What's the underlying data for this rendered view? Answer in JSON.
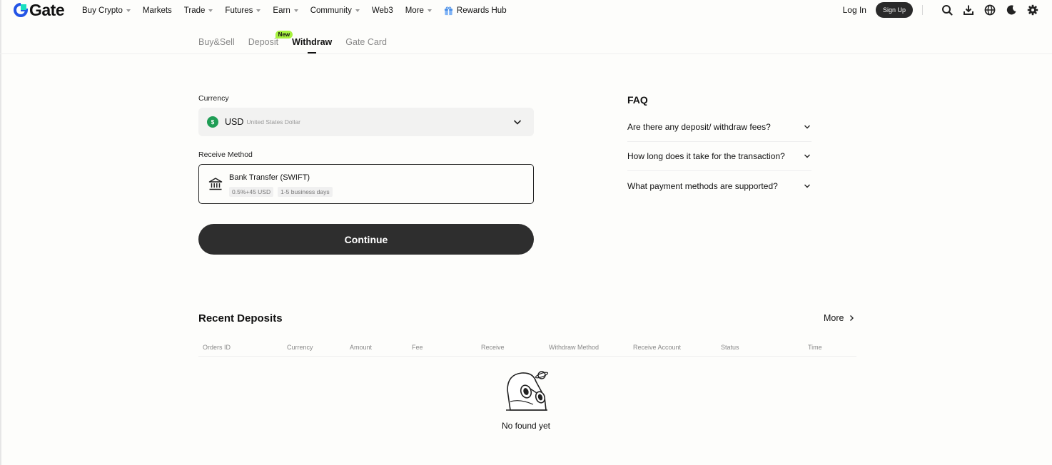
{
  "header": {
    "logo_text": "Gate",
    "nav": [
      {
        "label": "Buy Crypto",
        "has_caret": true
      },
      {
        "label": "Markets",
        "has_caret": false
      },
      {
        "label": "Trade",
        "has_caret": true
      },
      {
        "label": "Futures",
        "has_caret": true
      },
      {
        "label": "Earn",
        "has_caret": true
      },
      {
        "label": "Community",
        "has_caret": true
      },
      {
        "label": "Web3",
        "has_caret": false
      },
      {
        "label": "More",
        "has_caret": true
      },
      {
        "label": "Rewards Hub",
        "has_caret": false,
        "icon": "gift-box-icon"
      }
    ],
    "login_label": "Log In",
    "signup_label": "Sign Up",
    "icons": [
      "search-icon",
      "download-icon",
      "globe-icon",
      "moon-icon",
      "gear-icon"
    ]
  },
  "tabs": [
    {
      "label": "Buy&Sell",
      "active": false
    },
    {
      "label": "Deposit",
      "active": false,
      "badge": "New"
    },
    {
      "label": "Withdraw",
      "active": true
    },
    {
      "label": "Gate Card",
      "active": false
    }
  ],
  "form": {
    "currency_label": "Currency",
    "currency_code": "USD",
    "currency_name": "United States Dollar",
    "currency_symbol": "$",
    "method_label": "Receive Method",
    "method_title": "Bank Transfer (SWIFT)",
    "method_fee": "0.5%+45 USD",
    "method_time": "1-5 business days",
    "continue_label": "Continue"
  },
  "faq": {
    "title": "FAQ",
    "items": [
      "Are there any deposit/ withdraw fees?",
      "How long does it take for the transaction?",
      "What payment methods are supported?"
    ]
  },
  "recent": {
    "title": "Recent Deposits",
    "more_label": "More",
    "columns": [
      "Orders ID",
      "Currency",
      "Amount",
      "Fee",
      "Receive",
      "Withdraw Method",
      "Receive Account",
      "Status",
      "Time"
    ],
    "empty_text": "No found yet"
  },
  "colors": {
    "accent": "#2e2e2e",
    "new_badge": "#a7f23f",
    "usd_coin": "#1f9d55",
    "logo_blue": "#2354e6"
  }
}
